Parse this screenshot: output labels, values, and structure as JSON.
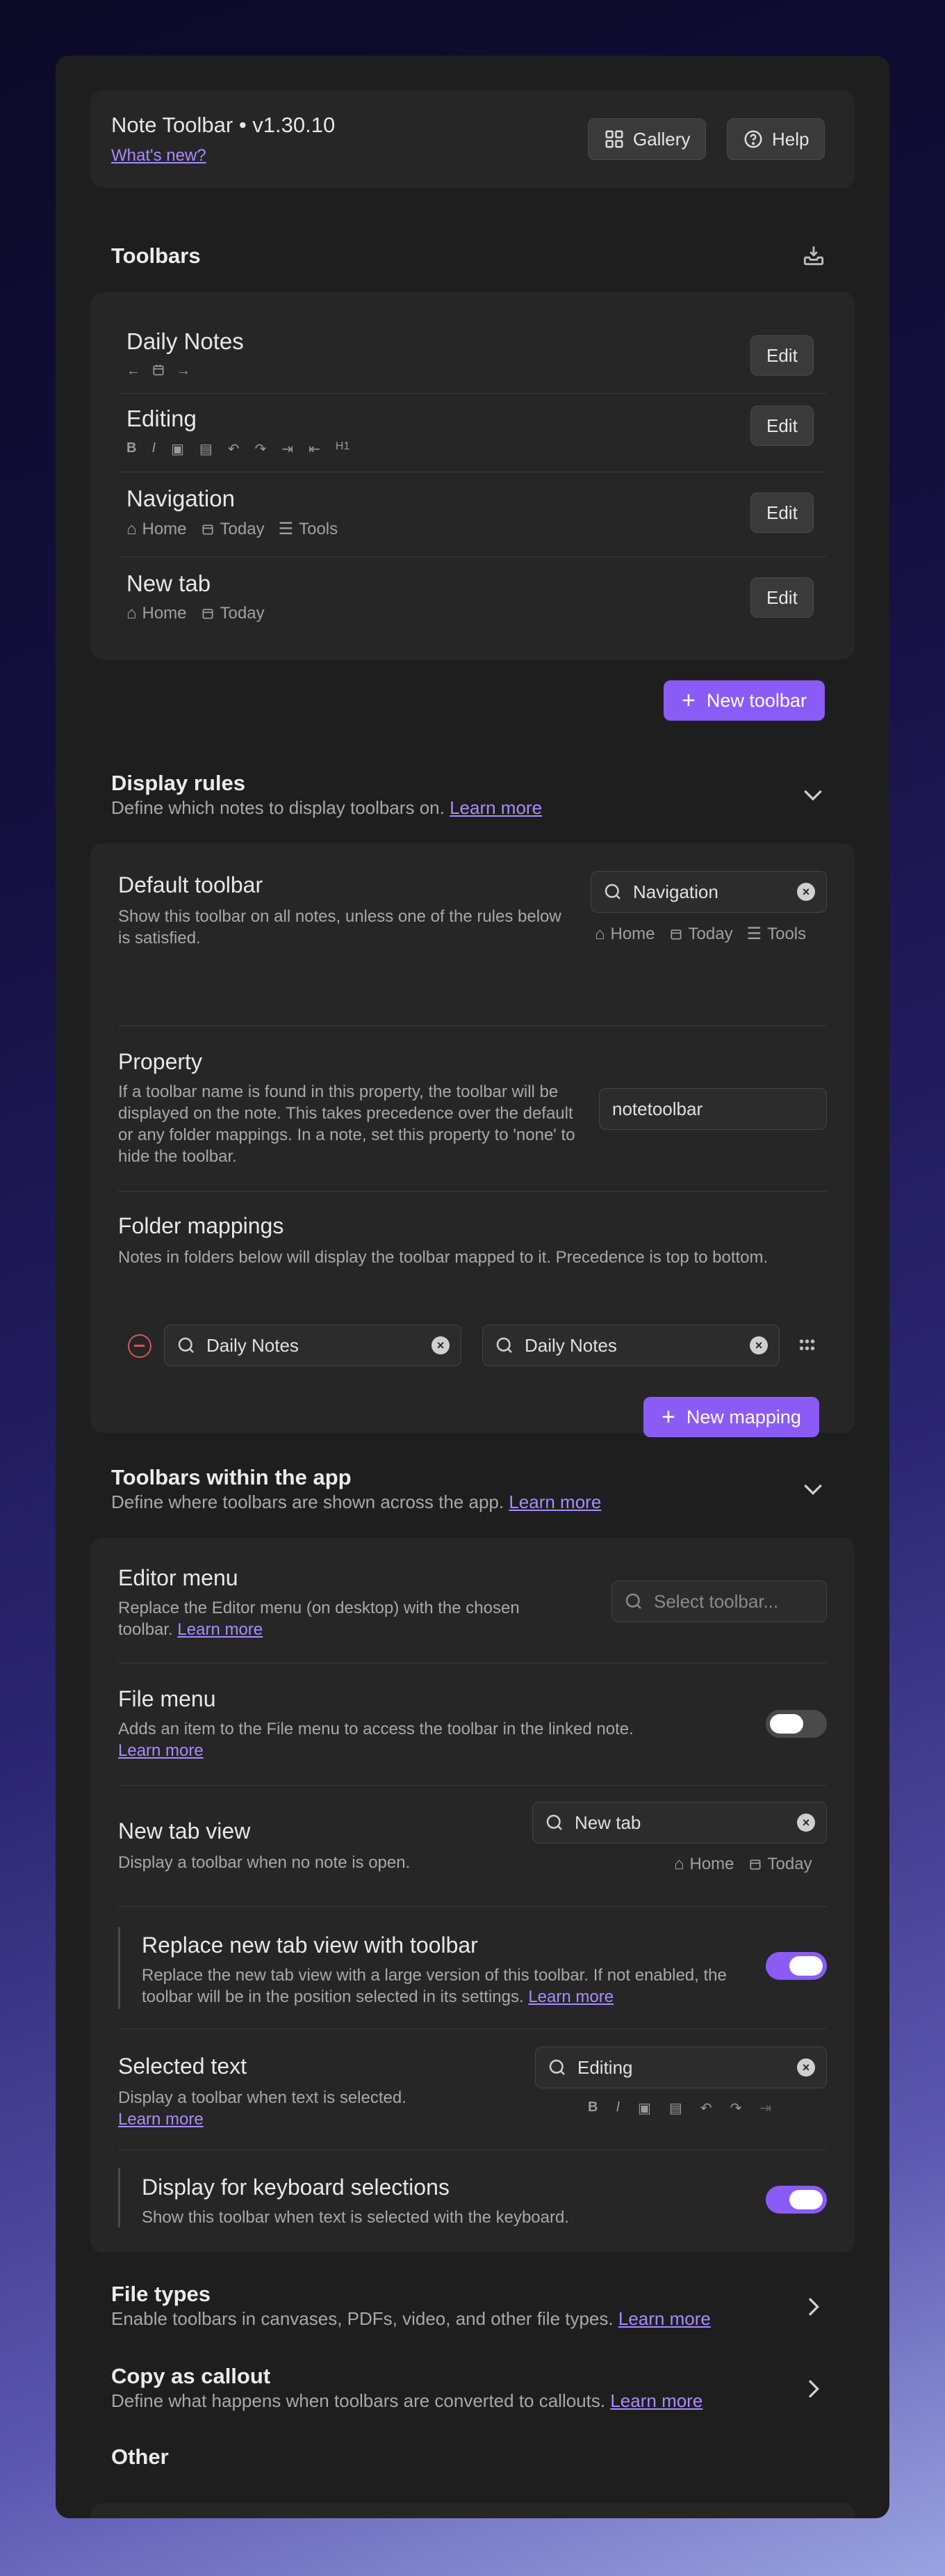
{
  "header": {
    "title": "Note Toolbar • v1.30.10",
    "whats_new": "What's new?",
    "gallery_label": "Gallery",
    "help_label": "Help"
  },
  "toolbars": {
    "title": "Toolbars",
    "items": [
      {
        "name": "Daily Notes",
        "edit": "Edit"
      },
      {
        "name": "Editing",
        "edit": "Edit"
      },
      {
        "name": "Navigation",
        "edit": "Edit",
        "preview": [
          "Home",
          "Today",
          "Tools"
        ]
      },
      {
        "name": "New tab",
        "edit": "Edit",
        "preview": [
          "Home",
          "Today"
        ]
      }
    ],
    "new_toolbar": "New toolbar"
  },
  "display_rules": {
    "title": "Display rules",
    "desc": "Define which notes to display toolbars on.",
    "learn_more": "Learn more",
    "default_toolbar": {
      "title": "Default toolbar",
      "desc": "Show this toolbar on all notes, unless one of the rules below is satisfied.",
      "value": "Navigation",
      "preview": [
        "Home",
        "Today",
        "Tools"
      ]
    },
    "property": {
      "title": "Property",
      "desc": "If a toolbar name is found in this property, the toolbar will be displayed on the note. This takes precedence over the default or any folder mappings. In a note, set this property to 'none' to hide the toolbar.",
      "value": "notetoolbar"
    },
    "folder_mappings": {
      "title": "Folder mappings",
      "desc": "Notes in folders below will display the toolbar mapped to it. Precedence is top to bottom.",
      "folder_value": "Daily Notes",
      "toolbar_value": "Daily Notes",
      "new_mapping": "New mapping"
    }
  },
  "app_toolbars": {
    "title": "Toolbars within the app",
    "desc": "Define where toolbars are shown across the app.",
    "learn_more": "Learn more",
    "editor_menu": {
      "title": "Editor menu",
      "desc": "Replace the Editor menu (on desktop) with the chosen toolbar.",
      "learn_more": "Learn more",
      "placeholder": "Select toolbar..."
    },
    "file_menu": {
      "title": "File menu",
      "desc": "Adds an item to the File menu to access the toolbar in the linked note.",
      "learn_more": "Learn more",
      "enabled": false
    },
    "new_tab_view": {
      "title": "New tab view",
      "desc": "Display a toolbar when no note is open.",
      "value": "New tab",
      "preview": [
        "Home",
        "Today"
      ]
    },
    "replace_new_tab": {
      "title": "Replace new tab view with toolbar",
      "desc": "Replace the new tab view with a large version of this toolbar. If not enabled, the toolbar will be in the position selected in its settings.",
      "learn_more": "Learn more",
      "enabled": true
    },
    "selected_text": {
      "title": "Selected text",
      "desc": "Display a toolbar when text is selected.",
      "learn_more": "Learn more",
      "value": "Editing"
    },
    "keyboard_selections": {
      "title": "Display for keyboard selections",
      "desc": "Show this toolbar when text is selected with the keyboard.",
      "enabled": true
    }
  },
  "file_types": {
    "title": "File types",
    "desc": "Enable toolbars in canvases, PDFs, video, and other file types.",
    "learn_more": "Learn more"
  },
  "copy_callout": {
    "title": "Copy as callout",
    "desc": "Define what happens when toolbars are converted to callouts.",
    "learn_more": "Learn more"
  },
  "other": {
    "title": "Other"
  },
  "colors": {
    "accent": "#8a5cf5",
    "panel": "#1e1e1e",
    "card": "#262626"
  }
}
